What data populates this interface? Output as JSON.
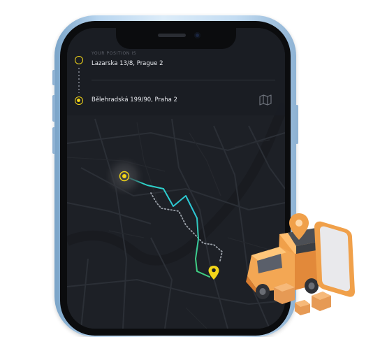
{
  "route": {
    "origin_caption": "YOUR POSITION IS",
    "origin_address": "Lazarska 13/8, Prague 2",
    "destination_address": "Bělehradská 199/90, Praha 2"
  },
  "colors": {
    "accent": "#f2d519",
    "route_start": "#2ed3c3",
    "route_end": "#3fcf84",
    "screen_background": "#1d2026"
  },
  "icons": {
    "map_button": "map-icon",
    "current_location": "location-dot-icon",
    "destination": "location-pin-icon"
  }
}
